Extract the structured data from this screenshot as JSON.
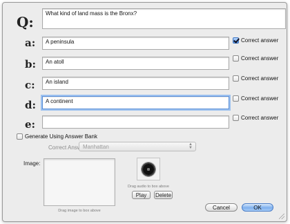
{
  "question": {
    "letter": "Q:",
    "value": "What kind of land mass is the Bronx?"
  },
  "answers": [
    {
      "letter": "a:",
      "value": "A peninsula",
      "correct_label": "Correct answer",
      "correct": true,
      "focused": false
    },
    {
      "letter": "b:",
      "value": "An atoll",
      "correct_label": "Correct answer",
      "correct": false,
      "focused": false
    },
    {
      "letter": "c:",
      "value": "An island",
      "correct_label": "Correct answer",
      "correct": false,
      "focused": false
    },
    {
      "letter": "d:",
      "value": "A continent",
      "correct_label": "Correct answer",
      "correct": false,
      "focused": true
    },
    {
      "letter": "e:",
      "value": "",
      "correct_label": "Correct answer",
      "correct": false,
      "focused": false
    }
  ],
  "answer_bank": {
    "generate_label": "Generate Using Answer Bank",
    "generate_checked": false,
    "correct_answer_label": "Correct Answer:",
    "correct_answer_value": "Manhattan"
  },
  "image": {
    "label": "Image:",
    "caption": "Drag image to box above"
  },
  "audio": {
    "icon": "speaker-icon",
    "caption": "Drag audio to box above",
    "play_label": "Play",
    "delete_label": "Delete"
  },
  "buttons": {
    "cancel_label": "Cancel",
    "ok_label": "OK"
  },
  "colors": {
    "dialog_bg": "#ececec",
    "focus_ring": "#9cc1f0",
    "default_button": "#7eb0ee"
  }
}
